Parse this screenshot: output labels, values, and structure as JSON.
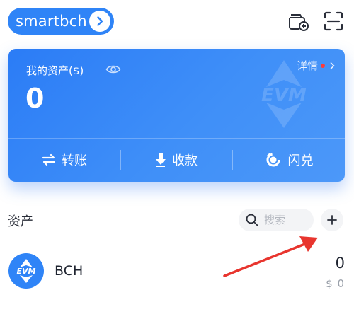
{
  "theme": {
    "accent": "#2f84f7",
    "arrow_color": "#e8352e"
  },
  "header": {
    "chain_label": "smartbch",
    "icons": [
      "chevron-right-icon",
      "add-wallet-icon",
      "scan-icon"
    ]
  },
  "card": {
    "assets_label": "我的资产($)",
    "balance": "0",
    "details_label": "详情",
    "watermark_text": "EVM",
    "actions": [
      {
        "label": "转账",
        "icon": "transfer-icon"
      },
      {
        "label": "收款",
        "icon": "receive-icon"
      },
      {
        "label": "闪兑",
        "icon": "swap-icon"
      }
    ]
  },
  "assets": {
    "title": "资产",
    "search_placeholder": "搜索",
    "tokens": [
      {
        "symbol": "BCH",
        "logo_text": "EVM",
        "amount": "0",
        "fiat": "$ 0"
      }
    ]
  }
}
